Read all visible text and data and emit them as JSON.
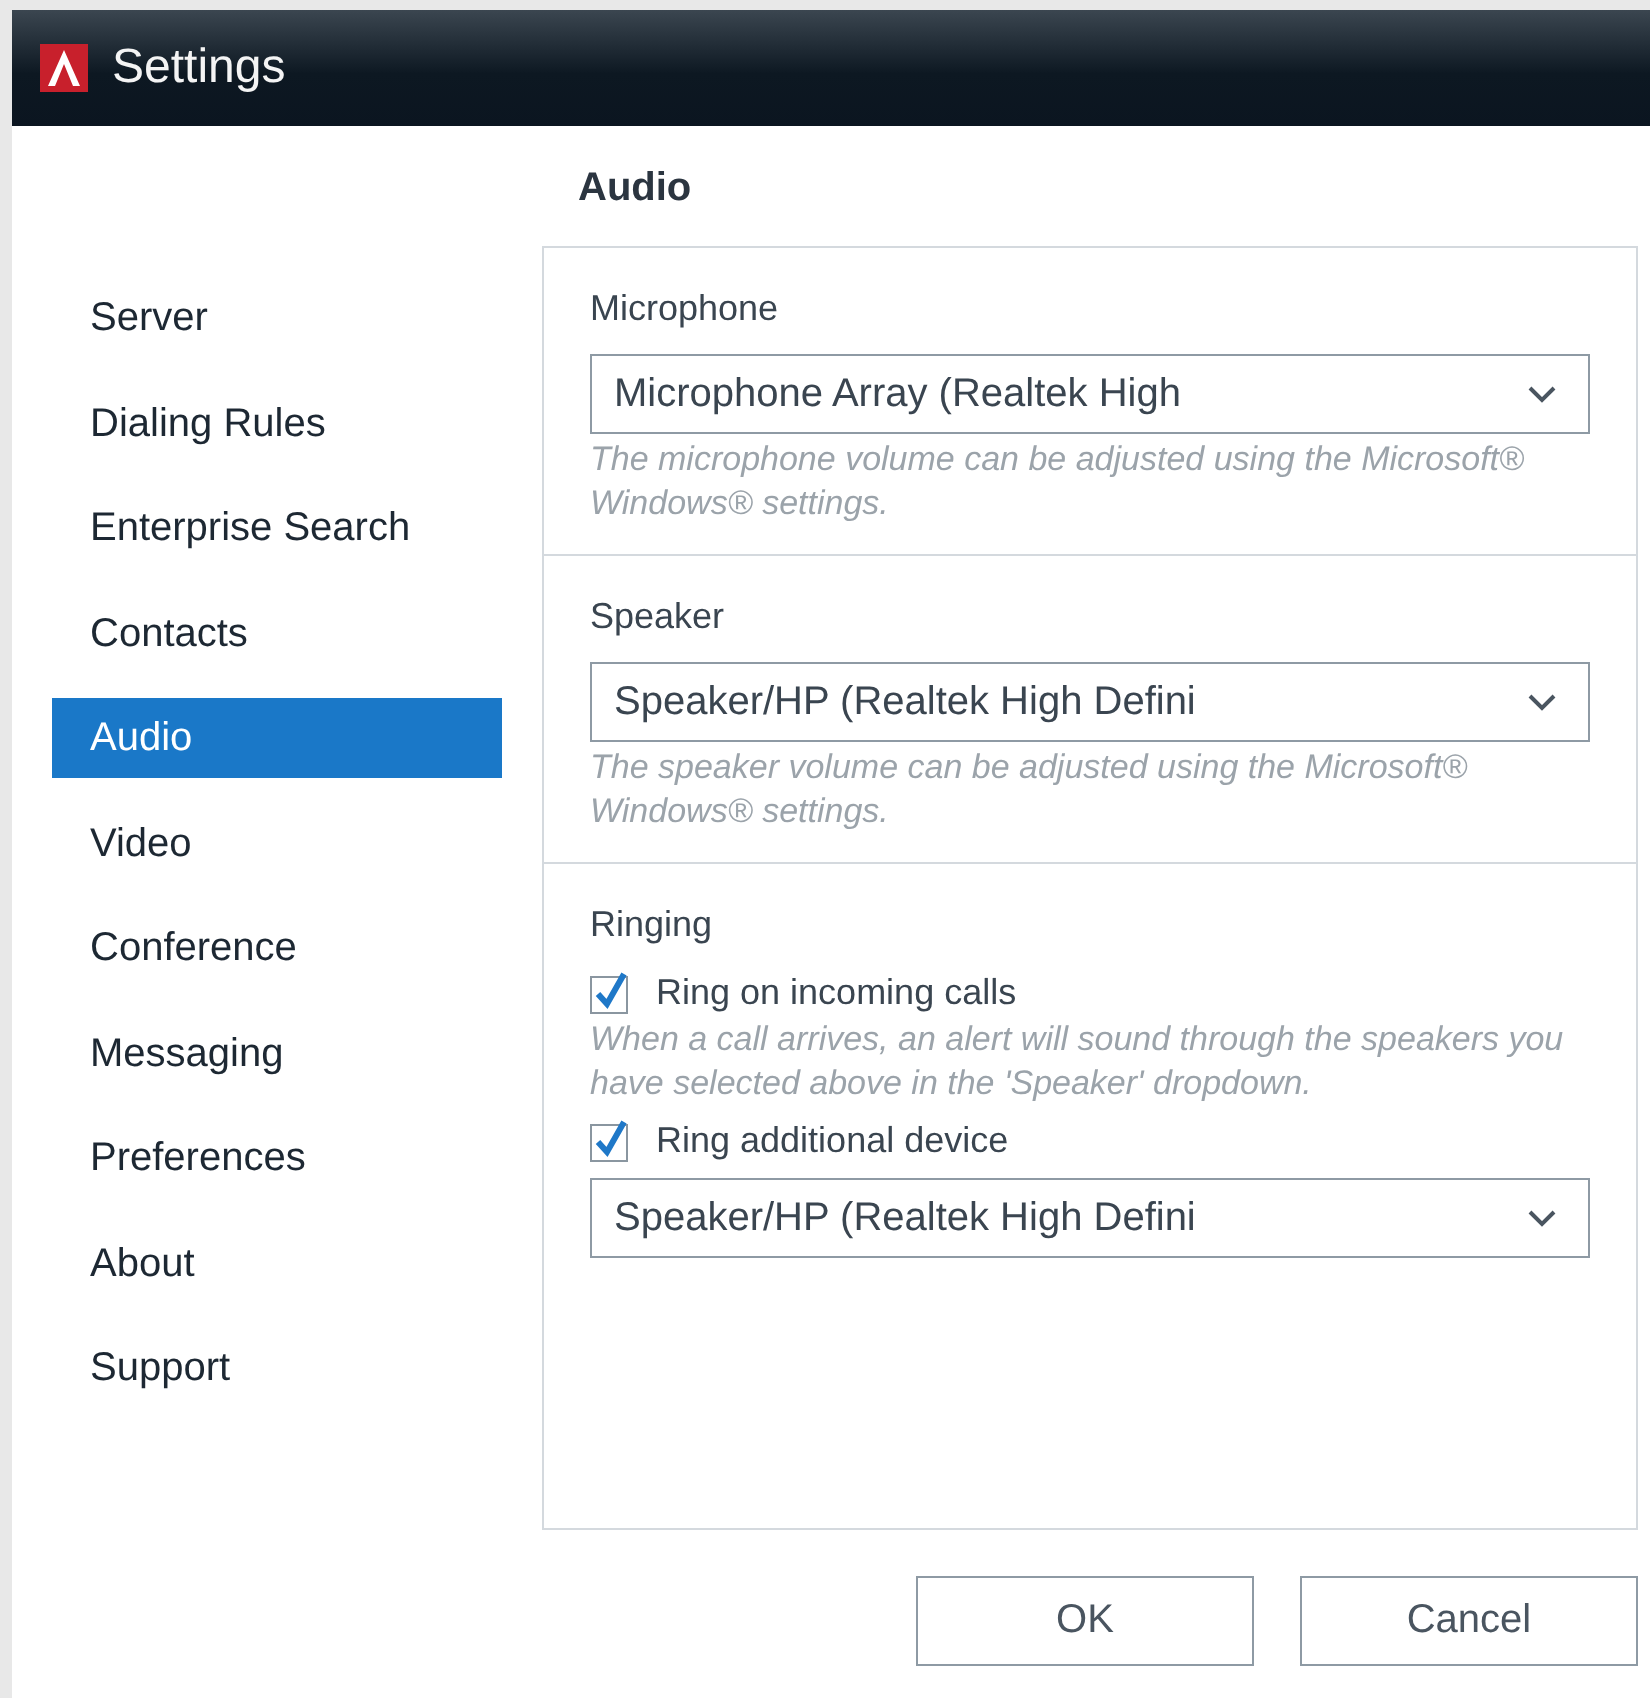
{
  "window": {
    "title": "Settings"
  },
  "sidebar": {
    "items": [
      {
        "label": "Server",
        "selected": false
      },
      {
        "label": "Dialing Rules",
        "selected": false
      },
      {
        "label": "Enterprise Search",
        "selected": false
      },
      {
        "label": "Contacts",
        "selected": false
      },
      {
        "label": "Audio",
        "selected": true
      },
      {
        "label": "Video",
        "selected": false
      },
      {
        "label": "Conference",
        "selected": false
      },
      {
        "label": "Messaging",
        "selected": false
      },
      {
        "label": "Preferences",
        "selected": false
      },
      {
        "label": "About",
        "selected": false
      },
      {
        "label": "Support",
        "selected": false
      }
    ]
  },
  "page": {
    "heading": "Audio",
    "sections": [
      {
        "label": "Microphone",
        "fields": [
          {
            "kind": "select",
            "value": "Microphone Array (Realtek High"
          },
          {
            "kind": "hint",
            "text": "The microphone volume can be adjusted using the Microsoft® Windows® settings."
          }
        ]
      },
      {
        "label": "Speaker",
        "fields": [
          {
            "kind": "select",
            "value": "Speaker/HP (Realtek High Defini"
          },
          {
            "kind": "hint",
            "text": "The speaker volume can be adjusted using the Microsoft® Windows® settings."
          }
        ]
      },
      {
        "label": "Ringing",
        "fields": [
          {
            "kind": "checkbox",
            "label": "Ring on incoming calls",
            "checked": true
          },
          {
            "kind": "hint",
            "text": "When a call arrives, an alert will sound through the speakers you have selected above in the 'Speaker' dropdown."
          },
          {
            "kind": "checkbox",
            "label": "Ring additional device",
            "checked": true
          },
          {
            "kind": "select",
            "value": "Speaker/HP (Realtek High Defini"
          }
        ]
      }
    ]
  },
  "buttons": [
    "OK",
    "Cancel"
  ]
}
